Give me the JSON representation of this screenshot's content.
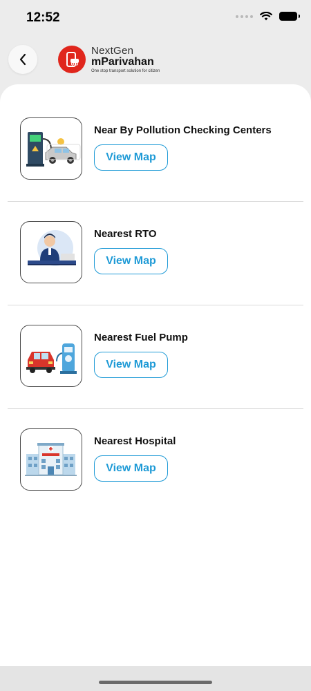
{
  "status_bar": {
    "time": "12:52"
  },
  "header": {
    "logo": {
      "nextgen": "NextGen",
      "brand": "mParivahan",
      "tagline": "One stop transport solution for citizen"
    }
  },
  "items": [
    {
      "title": "Near By Pollution Checking Centers",
      "button": "View Map",
      "icon": "pollution-check-illustration"
    },
    {
      "title": "Nearest RTO",
      "button": "View Map",
      "icon": "rto-officer-illustration"
    },
    {
      "title": "Nearest Fuel Pump",
      "button": "View Map",
      "icon": "fuel-pump-illustration"
    },
    {
      "title": "Nearest Hospital",
      "button": "View Map",
      "icon": "hospital-illustration"
    }
  ],
  "colors": {
    "accent": "#1e9ad6",
    "brand_red": "#e0261c"
  }
}
